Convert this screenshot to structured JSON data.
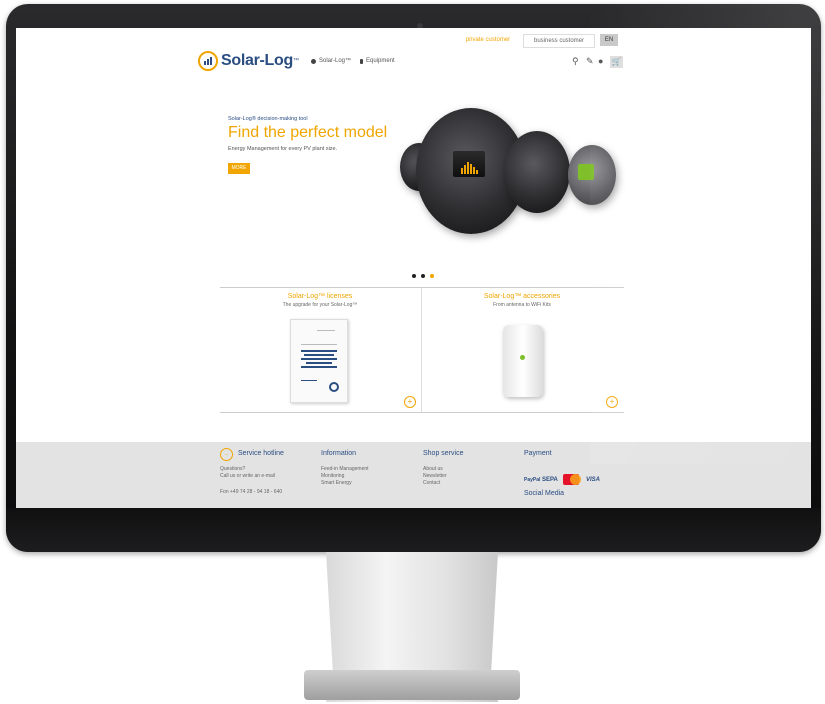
{
  "topbar": {
    "private_customer": "private customer",
    "business_customer": "business customer",
    "language": "EN"
  },
  "brand": {
    "name": "Solar-Log",
    "tm": "™"
  },
  "nav": {
    "items": [
      "Solar-Log™",
      "Equipment"
    ]
  },
  "icons": [
    "search-icon",
    "edit-icon",
    "user-icon",
    "cart-icon"
  ],
  "hero": {
    "eyebrow": "Solar-Log® decision-making tool",
    "title": "Find the perfect model",
    "text": "Energy Management for every PV plant size.",
    "button": "MORE"
  },
  "slider": {
    "count": 3,
    "active": 2
  },
  "cards": [
    {
      "title": "Solar-Log™ licenses",
      "subtitle": "The upgrade for your Solar-Log™"
    },
    {
      "title": "Solar-Log™ accessories",
      "subtitle": "From antenna to WiFi Kits"
    }
  ],
  "footer": {
    "hotline": {
      "title": "Service hotline",
      "line1": "Questions?",
      "line2": "Call us or write an e-mail",
      "phone": "Fon +49 74 28 - 94 18 - 640"
    },
    "information": {
      "title": "Information",
      "items": [
        "Feed-in Management",
        "Monitoring",
        "Smart Energy"
      ]
    },
    "shop_service": {
      "title": "Shop service",
      "items": [
        "About us",
        "Newsletter",
        "Contact"
      ]
    },
    "payment": {
      "title": "Payment",
      "methods": [
        "PayPal",
        "SEPA",
        "VISA"
      ],
      "social": "Social Media"
    }
  },
  "colors": {
    "accent": "#f0a500",
    "brand": "#2a4d82",
    "footer_bg": "#e3e3e3"
  }
}
